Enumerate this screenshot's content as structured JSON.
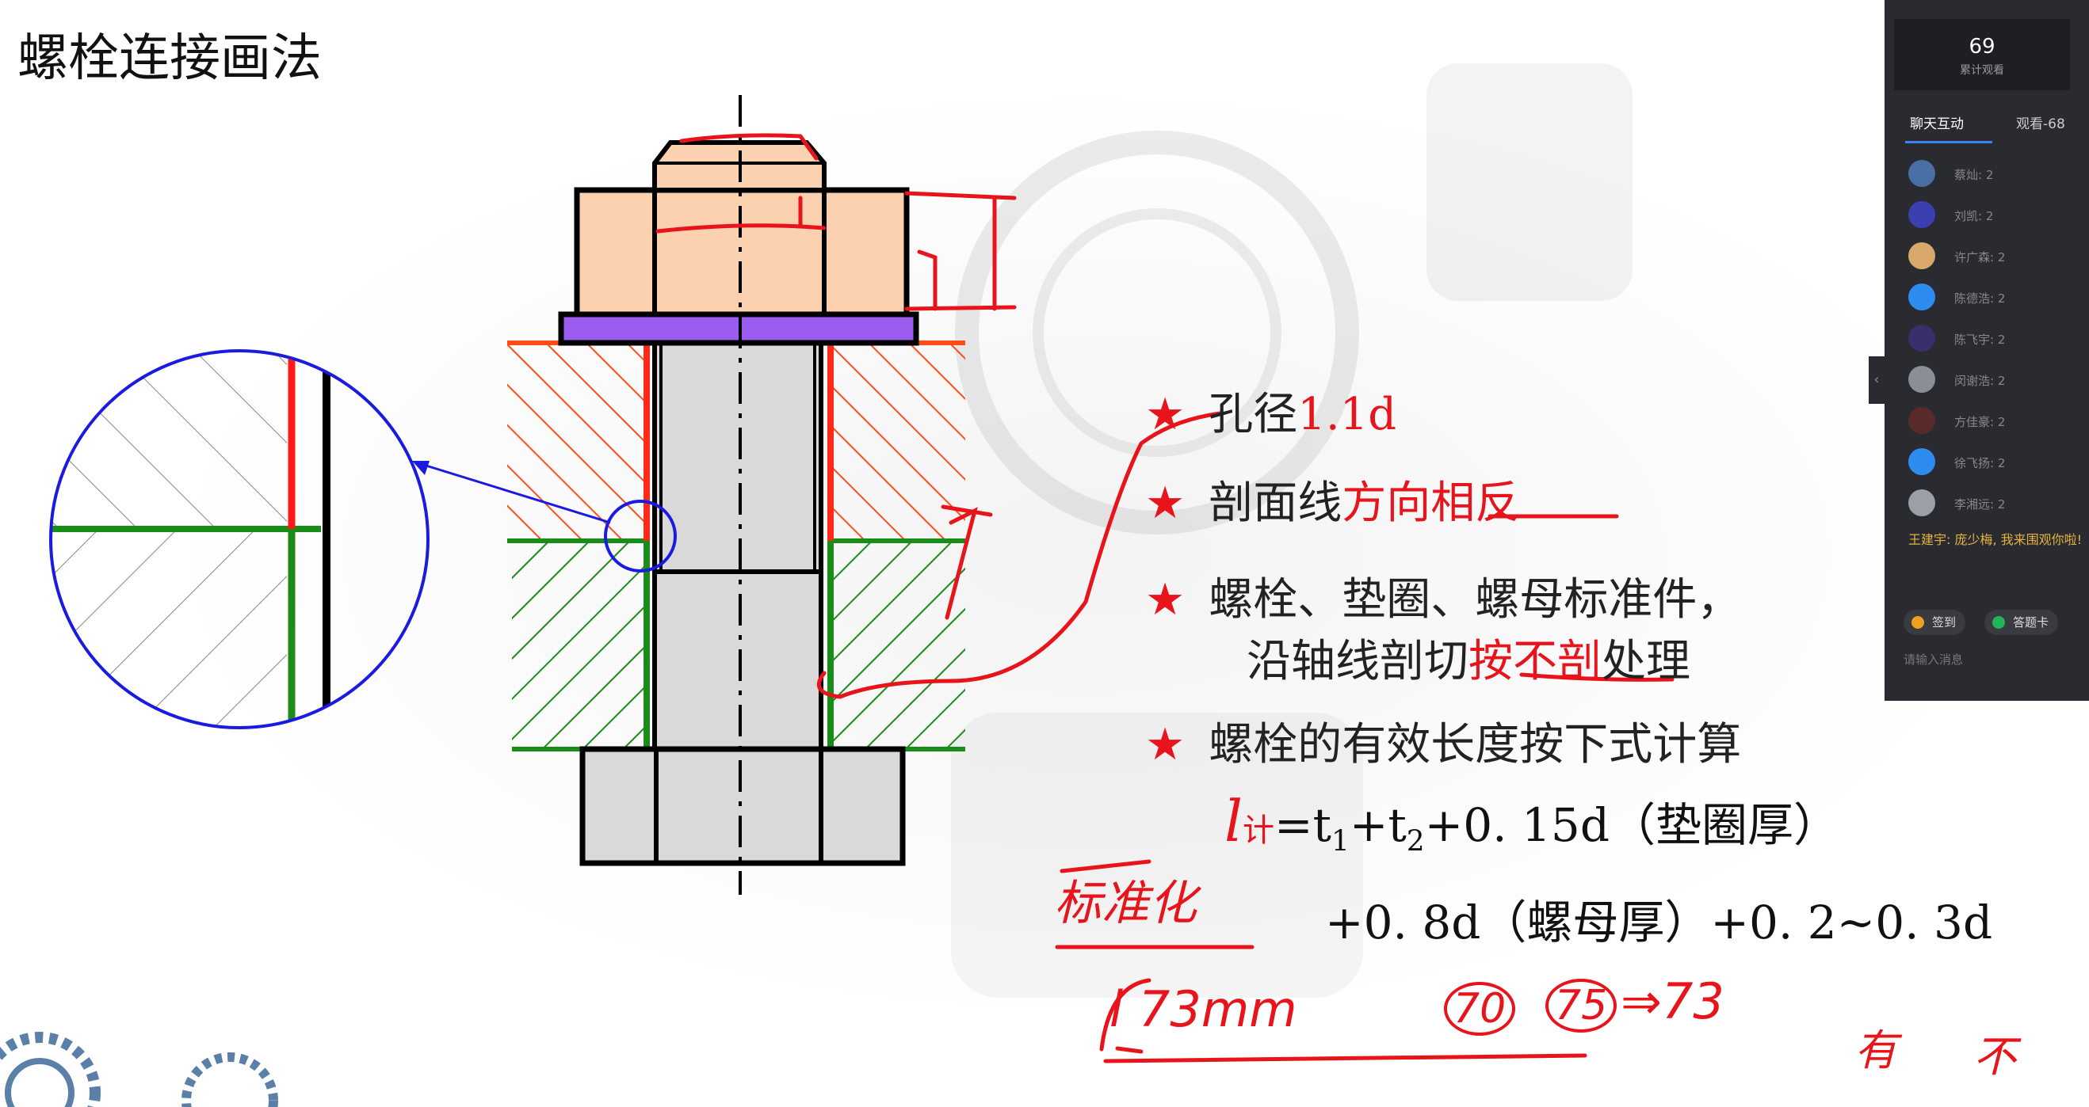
{
  "slide": {
    "title": "螺栓连接画法",
    "bullets": [
      {
        "plain": "孔径",
        "highlight": "1.1d",
        "after": ""
      },
      {
        "plain": "剖面线",
        "highlight": "方向相反",
        "after": ""
      },
      {
        "plain": "螺栓、垫圈、螺母标准件，",
        "highlight": "",
        "after": ""
      },
      {
        "plain": "沿轴线剖切",
        "highlight": "按不剖",
        "after": "处理"
      },
      {
        "plain": "螺栓的有效长度按下式计算",
        "highlight": "",
        "after": ""
      }
    ],
    "formula": {
      "l_var": "l",
      "l_sub": "计",
      "line1_rest": "=t",
      "t1_sub": "1",
      "plus_t": "+t",
      "t2_sub": "2",
      "line1_tail": "+0. 15d（垫圈厚）",
      "line2": "+0. 8d（螺母厚）+0. 2~0. 3d"
    },
    "handwriting": {
      "standardize": "标准化",
      "l_value": "l 73mm",
      "n70": "70",
      "n75": "75",
      "arrow_to": "⇒73",
      "note_have": "有",
      "note_not": "不"
    },
    "colors": {
      "nut": "#fcd1b0",
      "washer": "#9b5cf0",
      "bolt": "#d9d9d9",
      "upper_hatch": "#ff4d1a",
      "lower_hatch": "#1a8c1a",
      "annotation": "#e8141c",
      "detail_circle": "#1a1ae0"
    }
  },
  "live_panel": {
    "views_count": "69",
    "views_label": "累计观看",
    "tab_chat": "聊天互动",
    "tab_viewers": "观看-68",
    "viewers": [
      {
        "name": "蔡灿: 2",
        "color": "#4a6fa5"
      },
      {
        "name": "刘凯: 2",
        "color": "#3b3fb0"
      },
      {
        "name": "许广森: 2",
        "color": "#d8a96b"
      },
      {
        "name": "陈德浩: 2",
        "color": "#2d8cf0"
      },
      {
        "name": "陈飞宇: 2",
        "color": "#3a2e6b"
      },
      {
        "name": "闵谢浩: 2",
        "color": "#8a8f96"
      },
      {
        "name": "方佳豪: 2",
        "color": "#5a2a2a"
      },
      {
        "name": "徐飞扬: 2",
        "color": "#2d8cf0"
      },
      {
        "name": "李湘远: 2",
        "color": "#9aa0a6"
      }
    ],
    "message": "王建宇: 庞少梅, 我来围观你啦!",
    "sign_btn": "签到",
    "card_btn": "答题卡",
    "input_placeholder": "请输入消息"
  }
}
